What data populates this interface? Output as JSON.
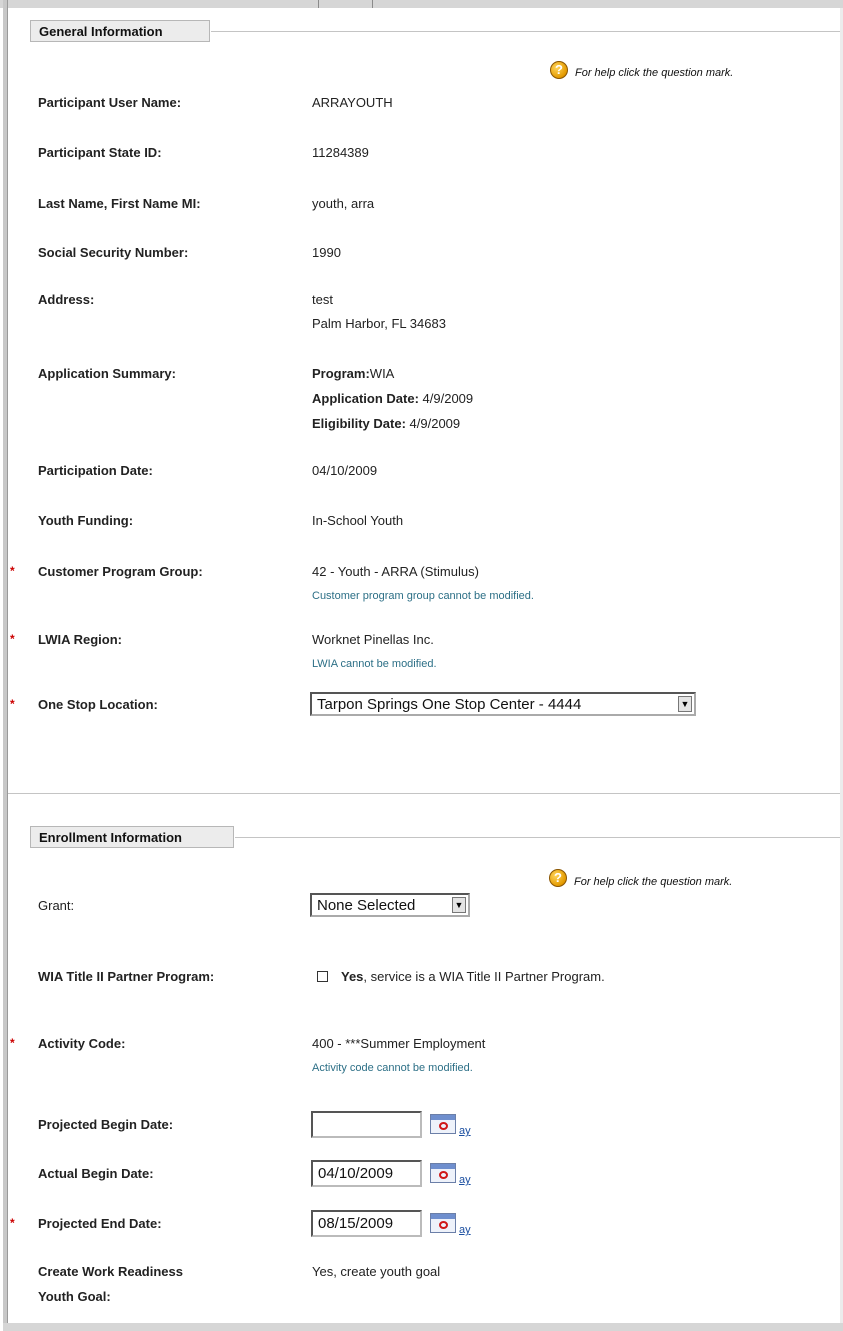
{
  "general": {
    "section_title": "General Information",
    "help_text": "For help click the question mark.",
    "fields": {
      "user_name": {
        "label": "Participant User Name:",
        "value": "ARRAYOUTH"
      },
      "state_id": {
        "label": "Participant State ID:",
        "value": "11284389"
      },
      "name": {
        "label": "Last Name, First Name MI:",
        "value": "youth, arra"
      },
      "ssn": {
        "label": "Social Security Number:",
        "value": "1990"
      },
      "address": {
        "label": "Address:",
        "line1": "test",
        "line2": "Palm Harbor, FL 34683"
      },
      "app_summary": {
        "label": "Application Summary:",
        "program_label": "Program:",
        "program_value": "WIA",
        "app_date_label": "Application Date:",
        "app_date_value": "4/9/2009",
        "elig_date_label": "Eligibility Date:",
        "elig_date_value": "4/9/2009"
      },
      "participation_date": {
        "label": "Participation Date:",
        "value": "04/10/2009"
      },
      "youth_funding": {
        "label": "Youth Funding:",
        "value": "In-School Youth"
      },
      "program_group": {
        "label": "Customer Program Group:",
        "value": "42 - Youth - ARRA (Stimulus)",
        "note": "Customer program group cannot be modified."
      },
      "lwia": {
        "label": "LWIA Region:",
        "value": "Worknet Pinellas Inc.",
        "note": "LWIA cannot be modified."
      },
      "one_stop": {
        "label": "One Stop Location:",
        "selected": "Tarpon Springs One Stop Center - 4444"
      }
    }
  },
  "enrollment": {
    "section_title": "Enrollment Information",
    "help_text": "For help click the question mark.",
    "grant": {
      "label": "Grant:",
      "selected": "None Selected"
    },
    "partner": {
      "label": "WIA Title II Partner Program:",
      "yes": "Yes",
      "text": ", service is a WIA Title II Partner Program."
    },
    "activity": {
      "label": "Activity Code:",
      "value": "400 - ***Summer Employment",
      "note": "Activity code cannot be modified."
    },
    "proj_begin": {
      "label": "Projected Begin Date:",
      "value": "",
      "day": "ay"
    },
    "actual_begin": {
      "label": "Actual Begin Date:",
      "value": "04/10/2009",
      "day": "ay"
    },
    "proj_end": {
      "label": "Projected End Date:",
      "value": "08/15/2009",
      "day": "ay"
    },
    "work_readiness": {
      "label_line1": "Create Work Readiness",
      "label_line2": "Youth Goal:",
      "value": "Yes, create youth goal"
    }
  },
  "required_marker": "*",
  "icons": {
    "help": "question-mark-icon",
    "calendar": "calendar-icon",
    "dropdown": "chevron-down-icon"
  },
  "colors": {
    "note": "#2c6f86",
    "required": "#cc0000",
    "link": "#1a4ea0"
  }
}
